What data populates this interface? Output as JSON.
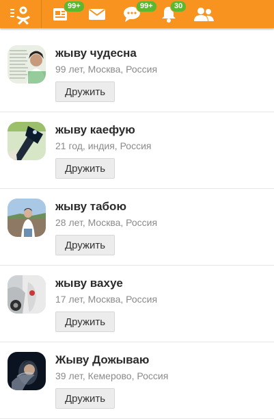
{
  "topbar": {
    "icons": [
      "ok-logo-icon",
      "feed-icon",
      "mail-icon",
      "chat-icon",
      "bell-icon",
      "friends-icon"
    ],
    "badges": {
      "feed": "99+",
      "chat": "99+",
      "notifications": "30"
    }
  },
  "colors": {
    "brand": "#f7931e",
    "badge": "#5cb82f"
  },
  "people": [
    {
      "name": "жыву чудесна",
      "meta": "99 лет, Москва, Россия",
      "button": "Дружить"
    },
    {
      "name": "жыву каефую",
      "meta": "21 год, индия, Россия",
      "button": "Дружить"
    },
    {
      "name": "жыву табою",
      "meta": "28 лет, Москва, Россия",
      "button": "Дружить"
    },
    {
      "name": "жыву вахуе",
      "meta": "17 лет, Москва, Россия",
      "button": "Дружить"
    },
    {
      "name": "Жыву Дожываю",
      "meta": "39 лет, Кемерово, Россия",
      "button": "Дружить"
    }
  ]
}
